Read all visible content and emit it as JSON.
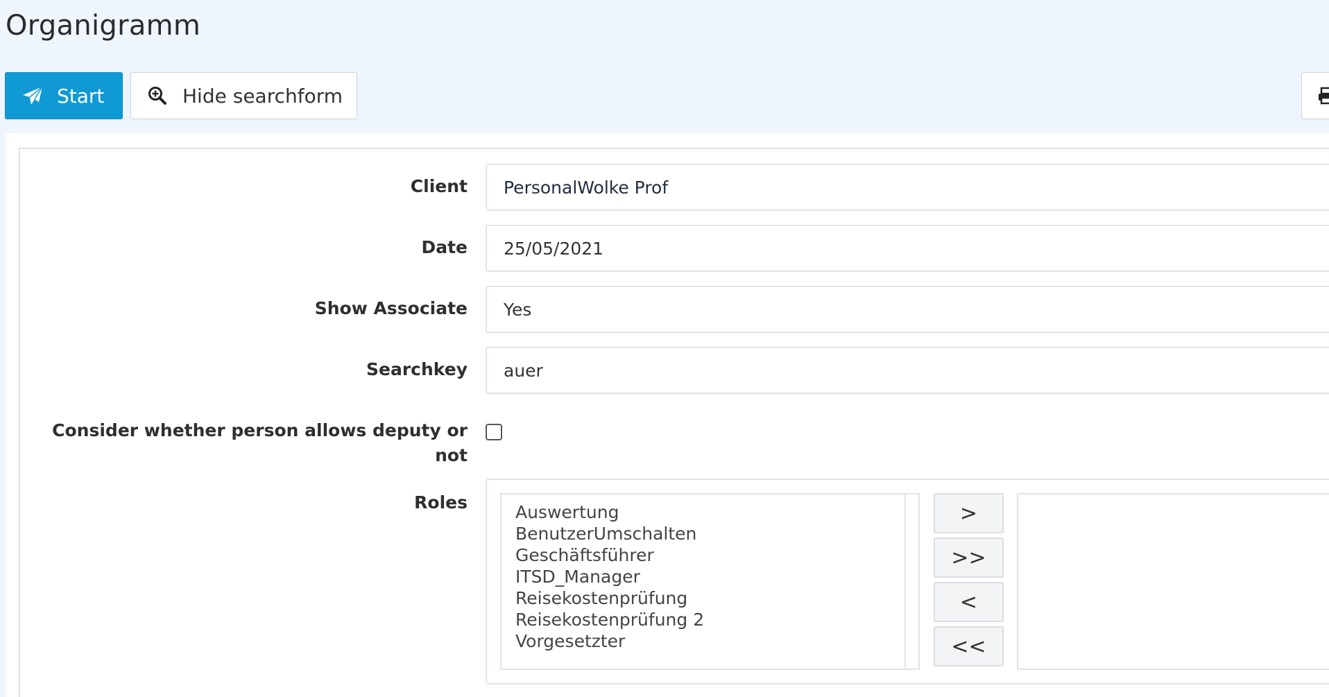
{
  "page": {
    "title": "Organigramm"
  },
  "toolbar": {
    "start_label": "Start",
    "search_label": "Hide searchform"
  },
  "form": {
    "client": {
      "label": "Client",
      "value": "PersonalWolke Prof"
    },
    "date": {
      "label": "Date",
      "value": "25/05/2021"
    },
    "show_associate": {
      "label": "Show Associate",
      "value": "Yes"
    },
    "searchkey": {
      "label": "Searchkey",
      "value": "auer"
    },
    "deputy": {
      "label_line1": "Consider whether person allows deputy or",
      "label_line2": "not",
      "checked": false
    },
    "roles": {
      "label": "Roles",
      "available": [
        "Auswertung",
        "BenutzerUmschalten",
        "Geschäftsführer",
        "ITSD_Manager",
        "Reisekostenprüfung",
        "Reisekostenprüfung 2",
        "Vorgesetzter"
      ],
      "selected": [],
      "buttons": {
        "add_one": ">",
        "add_all": ">>",
        "remove_one": "<",
        "remove_all": "<<"
      }
    }
  },
  "colors": {
    "accent": "#0f9ad4",
    "page_background": "#eef5fd"
  },
  "icons": {
    "start": "paper-plane-icon",
    "search": "zoom-in-icon",
    "print": "printer-icon"
  }
}
